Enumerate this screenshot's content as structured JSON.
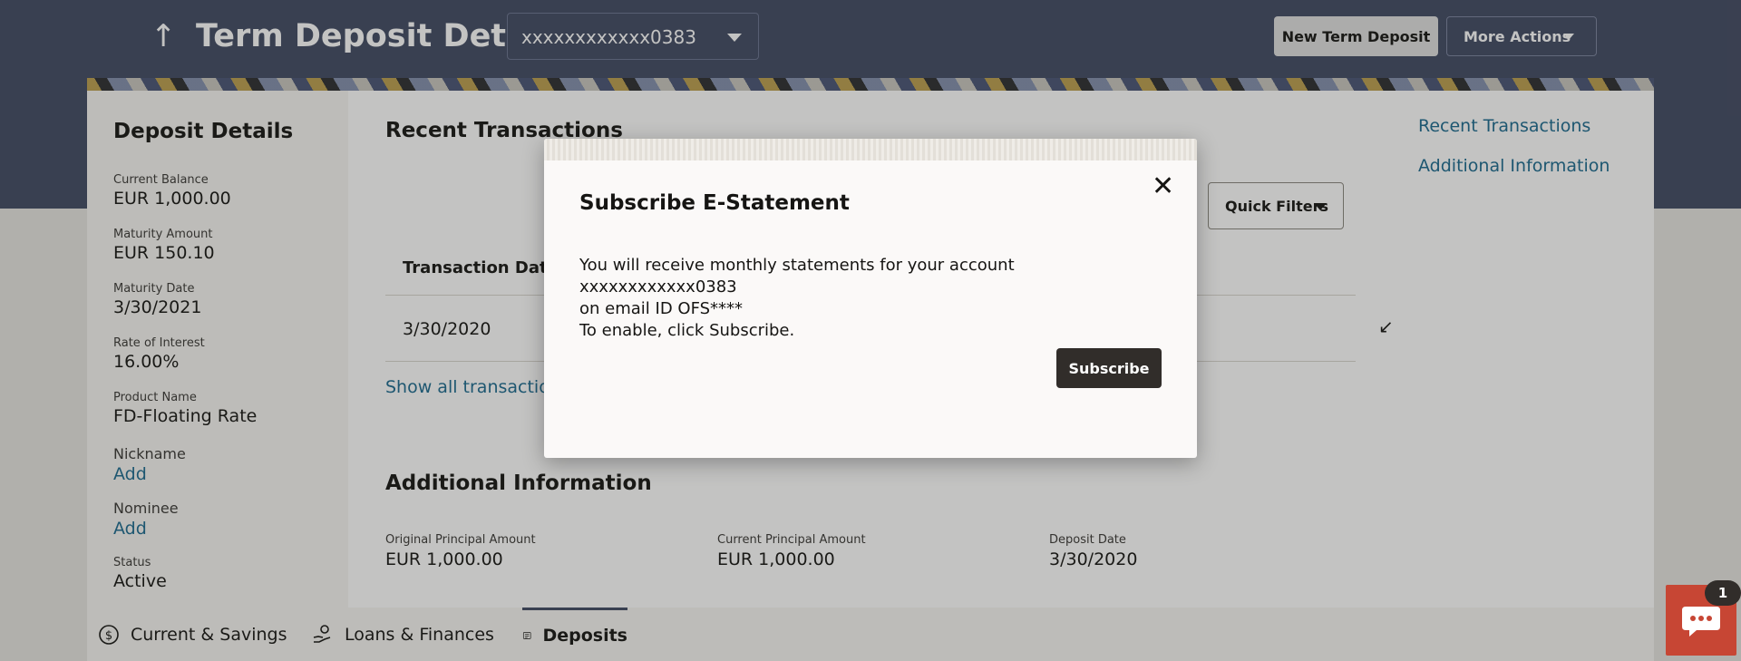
{
  "header": {
    "title": "Term Deposit Details",
    "back_icon": "arrow-up-icon",
    "account_selected": "xxxxxxxxxxxx0383",
    "new_button": "New Term Deposit",
    "more_button": "More Actions"
  },
  "deposit_details": {
    "title": "Deposit Details",
    "current_balance_label": "Current Balance",
    "current_balance_value": "EUR 1,000.00",
    "maturity_amount_label": "Maturity Amount",
    "maturity_amount_value": "EUR 150.10",
    "maturity_date_label": "Maturity Date",
    "maturity_date_value": "3/30/2021",
    "rate_label": "Rate of Interest",
    "rate_value": "16.00%",
    "product_label": "Product Name",
    "product_value": "FD-Floating Rate",
    "nickname_label": "Nickname",
    "nickname_value": "Add",
    "nominee_label": "Nominee",
    "nominee_value": "Add",
    "status_label": "Status",
    "status_value": "Active"
  },
  "recent": {
    "title": "Recent Transactions",
    "quick_filters": "Quick Filters",
    "col_date": "Transaction Date",
    "row_date": "3/30/2020",
    "show_all": "Show all transaction"
  },
  "right_links": {
    "recent": "Recent Transactions",
    "additional": "Additional Information"
  },
  "additional": {
    "title": "Additional Information",
    "orig_label": "Original Principal Amount",
    "orig_value": "EUR 1,000.00",
    "curr_label": "Current Principal Amount",
    "curr_value": "EUR 1,000.00",
    "date_label": "Deposit Date",
    "date_value": "3/30/2020"
  },
  "bottom_nav": {
    "current_savings": "Current & Savings",
    "loans": "Loans & Finances",
    "deposits": "Deposits"
  },
  "modal": {
    "title": "Subscribe E-Statement",
    "line1": "You will receive monthly statements for your account xxxxxxxxxxxx0383",
    "line2": "on email ID OFS****",
    "line3": "To enable, click Subscribe.",
    "subscribe": "Subscribe"
  },
  "chat": {
    "badge": "1"
  }
}
